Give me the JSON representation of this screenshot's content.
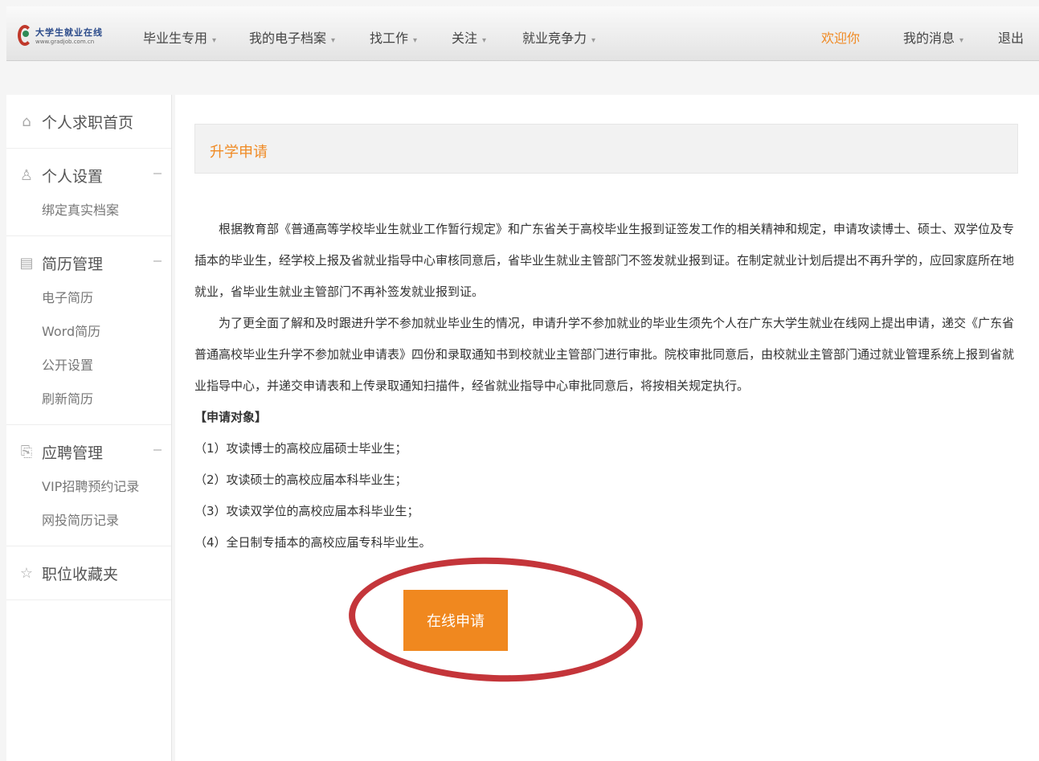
{
  "header": {
    "logo_text": "大学生就业在线",
    "logo_sub": "www.gradjob.com.cn",
    "nav": [
      {
        "label": "毕业生专用",
        "caret": "▾"
      },
      {
        "label": "我的电子档案",
        "caret": "▾"
      },
      {
        "label": "找工作",
        "caret": "▾"
      },
      {
        "label": "关注",
        "caret": "▾"
      },
      {
        "label": "就业竞争力",
        "caret": "▾"
      }
    ],
    "welcome": "欢迎你",
    "messages": {
      "label": "我的消息",
      "caret": "▾"
    },
    "logout": "退出",
    "accent": "#f08a24"
  },
  "sidebar": {
    "home": {
      "label": "个人求职首页",
      "icon": "home-icon"
    },
    "groups": [
      {
        "label": "个人设置",
        "icon": "user-icon",
        "items": [
          "绑定真实档案"
        ]
      },
      {
        "label": "简历管理",
        "icon": "document-icon",
        "items": [
          "电子简历",
          "Word简历",
          "公开设置",
          "刷新简历"
        ]
      },
      {
        "label": "应聘管理",
        "icon": "file-arrow-icon",
        "items": [
          "VIP招聘预约记录",
          "网投简历记录"
        ]
      }
    ],
    "favorites": {
      "label": "职位收藏夹",
      "icon": "star-icon"
    }
  },
  "main": {
    "title": "升学申请",
    "para1": "根据教育部《普通高等学校毕业生就业工作暂行规定》和广东省关于高校毕业生报到证签发工作的相关精神和规定，申请攻读博士、硕士、双学位及专插本的毕业生，经学校上报及省就业指导中心审核同意后，省毕业生就业主管部门不签发就业报到证。在制定就业计划后提出不再升学的，应回家庭所在地就业，省毕业生就业主管部门不再补签发就业报到证。",
    "para2": "为了更全面了解和及时跟进升学不参加就业毕业生的情况，申请升学不参加就业的毕业生须先个人在广东大学生就业在线网上提出申请，递交《广东省普通高校毕业生升学不参加就业申请表》四份和录取通知书到校就业主管部门进行审批。院校审批同意后，由校就业主管部门通过就业管理系统上报到省就业指导中心，并递交申请表和上传录取通知扫描件，经省就业指导中心审批同意后，将按相关规定执行。",
    "target_heading": "【申请对象】",
    "targets": [
      "（1）攻读博士的高校应届硕士毕业生；",
      "（2）攻读硕士的高校应届本科毕业生；",
      "（3）攻读双学位的高校应届本科毕业生；",
      "（4）全日制专插本的高校应届专科毕业生。"
    ],
    "apply_button": "在线申请"
  }
}
